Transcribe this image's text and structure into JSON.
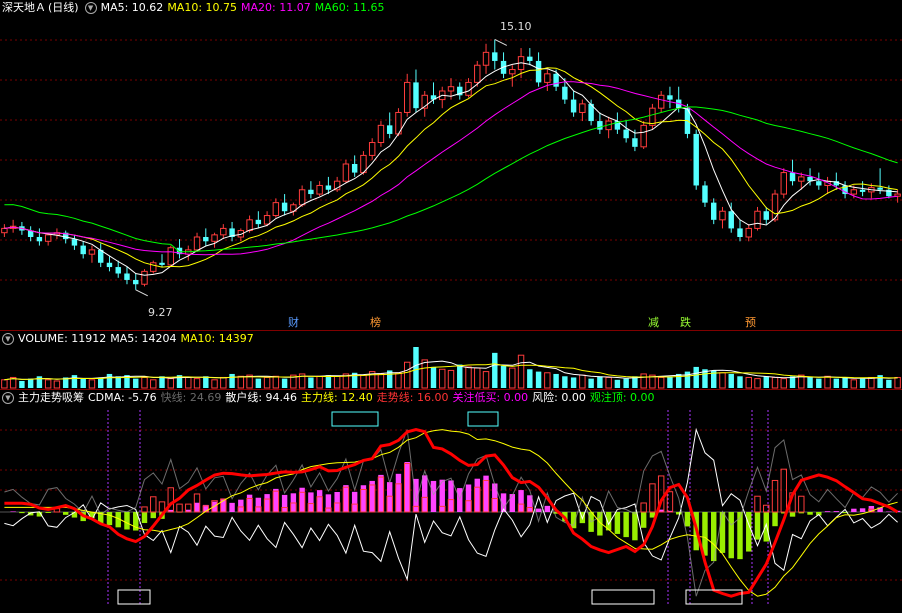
{
  "colors": {
    "up": "#ff3c3c",
    "down": "#54ffff",
    "ma5": "#ffffff",
    "ma10": "#ffff00",
    "ma20": "#ff00ff",
    "ma60": "#00ff00",
    "grid": "#7a0000",
    "cdma": "#ffff66",
    "fast": "#9a9a9a",
    "retail": "#ffffff",
    "main": "#ffff00",
    "trend": "#ff0000",
    "buy": "#ff00ff",
    "risk": "#ffffff",
    "top": "#00ff00",
    "histPos": "#ff44ff",
    "histNeg": "#99ee00"
  },
  "price_panel": {
    "stock_name": "深天地Ａ",
    "period": "(日线)",
    "ma5_label": "MA5: 10.62",
    "ma10_label": "MA10: 10.75",
    "ma20_label": "MA20: 11.07",
    "ma60_label": "MA60: 11.65",
    "high_label": "15.10",
    "low_label": "9.27",
    "events": [
      {
        "text": "财",
        "color": "#5a9bff"
      },
      {
        "text": "榜",
        "color": "#ff9933"
      },
      {
        "text": "减",
        "color": "#99ff33"
      },
      {
        "text": "跌",
        "color": "#99ff33"
      },
      {
        "text": "预",
        "color": "#ff9933"
      }
    ]
  },
  "volume_panel": {
    "title": "VOLUME: 11912",
    "ma5_label": "MA5: 14204",
    "ma10_label": "MA10: 14397"
  },
  "indicator_panel": {
    "title": "主力走势吸筹",
    "cdma_label": "CDMA: -5.76",
    "fast_label": "快线: 24.69",
    "retail_label": "散户线: 94.46",
    "main_label": "主力线: 12.40",
    "trend_label": "走势线: 16.00",
    "buy_label": "关注低买: 0.00",
    "risk_label": "风险: 0.00",
    "top_label": "观注顶: 0.00"
  },
  "chart_data": {
    "type": "candlestick",
    "title": "深天地Ａ (日线)",
    "high_marker": 15.1,
    "low_marker": 9.27,
    "ylim": [
      8.8,
      15.6
    ],
    "ohlc": [
      [
        10.6,
        10.8,
        10.5,
        10.7
      ],
      [
        10.7,
        10.9,
        10.6,
        10.75
      ],
      [
        10.75,
        10.85,
        10.55,
        10.65
      ],
      [
        10.65,
        10.75,
        10.4,
        10.5
      ],
      [
        10.5,
        10.7,
        10.3,
        10.4
      ],
      [
        10.4,
        10.6,
        10.3,
        10.55
      ],
      [
        10.55,
        10.7,
        10.45,
        10.6
      ],
      [
        10.6,
        10.65,
        10.35,
        10.45
      ],
      [
        10.45,
        10.55,
        10.2,
        10.3
      ],
      [
        10.3,
        10.4,
        10.0,
        10.1
      ],
      [
        10.1,
        10.3,
        9.9,
        10.2
      ],
      [
        10.2,
        10.35,
        9.8,
        9.9
      ],
      [
        9.9,
        10.05,
        9.7,
        9.8
      ],
      [
        9.8,
        9.95,
        9.55,
        9.65
      ],
      [
        9.65,
        9.8,
        9.4,
        9.5
      ],
      [
        9.5,
        9.65,
        9.27,
        9.4
      ],
      [
        9.4,
        9.75,
        9.35,
        9.7
      ],
      [
        9.7,
        9.95,
        9.65,
        9.9
      ],
      [
        9.9,
        10.1,
        9.8,
        9.85
      ],
      [
        9.85,
        10.3,
        9.8,
        10.25
      ],
      [
        10.25,
        10.45,
        10.0,
        10.1
      ],
      [
        10.1,
        10.3,
        9.95,
        10.2
      ],
      [
        10.2,
        10.6,
        10.15,
        10.5
      ],
      [
        10.5,
        10.7,
        10.3,
        10.4
      ],
      [
        10.4,
        10.6,
        10.25,
        10.55
      ],
      [
        10.55,
        10.8,
        10.45,
        10.7
      ],
      [
        10.7,
        10.85,
        10.4,
        10.5
      ],
      [
        10.5,
        10.7,
        10.4,
        10.65
      ],
      [
        10.65,
        11.0,
        10.6,
        10.9
      ],
      [
        10.9,
        11.1,
        10.7,
        10.8
      ],
      [
        10.8,
        11.1,
        10.75,
        11.0
      ],
      [
        11.0,
        11.4,
        10.95,
        11.3
      ],
      [
        11.3,
        11.5,
        11.0,
        11.1
      ],
      [
        11.1,
        11.3,
        11.0,
        11.25
      ],
      [
        11.25,
        11.7,
        11.2,
        11.6
      ],
      [
        11.6,
        11.8,
        11.4,
        11.5
      ],
      [
        11.5,
        11.8,
        11.45,
        11.7
      ],
      [
        11.7,
        11.9,
        11.5,
        11.6
      ],
      [
        11.6,
        11.9,
        11.55,
        11.8
      ],
      [
        11.8,
        12.3,
        11.75,
        12.2
      ],
      [
        12.2,
        12.4,
        11.9,
        12.0
      ],
      [
        12.0,
        12.5,
        11.95,
        12.4
      ],
      [
        12.4,
        12.8,
        12.3,
        12.7
      ],
      [
        12.7,
        13.2,
        12.6,
        13.1
      ],
      [
        13.1,
        13.4,
        12.8,
        12.9
      ],
      [
        12.9,
        13.5,
        12.85,
        13.4
      ],
      [
        13.4,
        14.3,
        13.3,
        14.1
      ],
      [
        14.1,
        14.4,
        13.4,
        13.5
      ],
      [
        13.5,
        13.9,
        13.3,
        13.8
      ],
      [
        13.8,
        14.1,
        13.6,
        13.7
      ],
      [
        13.7,
        14.0,
        13.5,
        13.9
      ],
      [
        13.9,
        14.2,
        13.7,
        14.0
      ],
      [
        14.0,
        14.1,
        13.7,
        13.8
      ],
      [
        13.8,
        14.2,
        13.75,
        14.1
      ],
      [
        14.1,
        14.6,
        14.0,
        14.5
      ],
      [
        14.5,
        15.0,
        14.3,
        14.8
      ],
      [
        14.8,
        15.1,
        14.4,
        14.6
      ],
      [
        14.6,
        14.8,
        14.2,
        14.3
      ],
      [
        14.3,
        14.5,
        14.0,
        14.4
      ],
      [
        14.4,
        14.9,
        14.2,
        14.7
      ],
      [
        14.7,
        14.9,
        14.5,
        14.6
      ],
      [
        14.6,
        14.8,
        14.0,
        14.1
      ],
      [
        14.1,
        14.4,
        13.9,
        14.3
      ],
      [
        14.3,
        14.4,
        13.9,
        14.0
      ],
      [
        14.0,
        14.2,
        13.6,
        13.7
      ],
      [
        13.7,
        13.9,
        13.3,
        13.4
      ],
      [
        13.4,
        13.7,
        13.2,
        13.6
      ],
      [
        13.6,
        13.7,
        13.1,
        13.2
      ],
      [
        13.2,
        13.4,
        12.9,
        13.0
      ],
      [
        13.0,
        13.3,
        12.8,
        13.2
      ],
      [
        13.2,
        13.4,
        12.9,
        13.0
      ],
      [
        13.0,
        13.2,
        12.7,
        12.8
      ],
      [
        12.8,
        13.0,
        12.5,
        12.6
      ],
      [
        12.6,
        13.2,
        12.55,
        13.1
      ],
      [
        13.1,
        13.6,
        13.0,
        13.5
      ],
      [
        13.5,
        13.9,
        13.4,
        13.8
      ],
      [
        13.8,
        14.0,
        13.5,
        13.7
      ],
      [
        13.7,
        14.0,
        13.4,
        13.5
      ],
      [
        13.5,
        13.6,
        12.8,
        12.9
      ],
      [
        12.9,
        13.0,
        11.6,
        11.7
      ],
      [
        11.7,
        11.8,
        11.2,
        11.3
      ],
      [
        11.3,
        11.4,
        10.8,
        10.9
      ],
      [
        10.9,
        11.2,
        10.7,
        11.1
      ],
      [
        11.1,
        11.3,
        10.6,
        10.7
      ],
      [
        10.7,
        10.9,
        10.4,
        10.5
      ],
      [
        10.5,
        10.8,
        10.4,
        10.7
      ],
      [
        10.7,
        11.2,
        10.65,
        11.1
      ],
      [
        11.1,
        11.2,
        10.8,
        10.9
      ],
      [
        10.9,
        11.6,
        10.85,
        11.5
      ],
      [
        11.5,
        12.1,
        11.4,
        12.0
      ],
      [
        12.0,
        12.3,
        11.7,
        11.8
      ],
      [
        11.8,
        12.0,
        11.6,
        11.9
      ],
      [
        11.9,
        12.1,
        11.7,
        11.8
      ],
      [
        11.8,
        12.0,
        11.6,
        11.7
      ],
      [
        11.7,
        11.9,
        11.5,
        11.8
      ],
      [
        11.8,
        12.0,
        11.6,
        11.7
      ],
      [
        11.7,
        11.8,
        11.4,
        11.5
      ],
      [
        11.5,
        11.7,
        11.4,
        11.6
      ],
      [
        11.6,
        11.8,
        11.45,
        11.55
      ],
      [
        11.55,
        11.75,
        11.4,
        11.65
      ],
      [
        11.65,
        12.1,
        11.5,
        11.6
      ],
      [
        11.6,
        11.7,
        11.4,
        11.45
      ],
      [
        11.45,
        11.6,
        11.3,
        11.5
      ]
    ],
    "volume": [
      7,
      9,
      6,
      8,
      10,
      7,
      6,
      9,
      11,
      8,
      7,
      9,
      12,
      10,
      11,
      8,
      9,
      7,
      10,
      8,
      11,
      9,
      8,
      10,
      7,
      9,
      12,
      10,
      11,
      8,
      9,
      10,
      8,
      11,
      12,
      9,
      10,
      11,
      10,
      12,
      13,
      11,
      14,
      12,
      15,
      13,
      22,
      35,
      24,
      18,
      16,
      15,
      20,
      18,
      17,
      14,
      30,
      19,
      17,
      28,
      16,
      14,
      13,
      12,
      10,
      9,
      11,
      8,
      10,
      9,
      7,
      8,
      10,
      12,
      11,
      9,
      10,
      12,
      14,
      18,
      16,
      15,
      13,
      12,
      10,
      9,
      8,
      10,
      9,
      8,
      10,
      11,
      9,
      8,
      10,
      8,
      9,
      7,
      8,
      9,
      11,
      7,
      9
    ]
  }
}
